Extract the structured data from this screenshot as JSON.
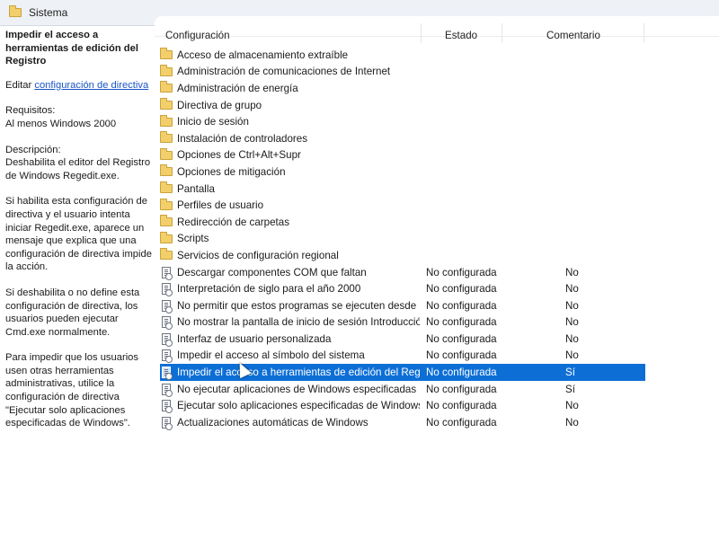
{
  "window": {
    "title": "Sistema",
    "title_icon": "folder-icon"
  },
  "left_pane": {
    "heading": "Impedir el acceso a herramientas de edición del Registro",
    "edit_prefix": "Editar ",
    "edit_link": "configuración de directiva",
    "requirements_label": "Requisitos:",
    "requirements_value": "Al menos Windows 2000",
    "description_label": "Descripción:",
    "description_text": "Deshabilita el editor del Registro de Windows Regedit.exe.",
    "paragraph_enabled": "Si habilita esta configuración de directiva y el usuario intenta iniciar Regedit.exe, aparece un mensaje que explica que una configuración de directiva impide la acción.",
    "paragraph_disabled": "Si deshabilita o no define esta configuración de directiva, los usuarios pueden ejecutar Cmd.exe normalmente.",
    "paragraph_block": "Para impedir que los usuarios usen otras herramientas administrativas, utilice la configuración de directiva \"Ejecutar solo aplicaciones especificadas de Windows\"."
  },
  "columns": {
    "config": "Configuración",
    "estado": "Estado",
    "comentario": "Comentario"
  },
  "folders": [
    "Acceso de almacenamiento extraíble",
    "Administración de comunicaciones de Internet",
    "Administración de energía",
    "Directiva de grupo",
    "Inicio de sesión",
    "Instalación de controladores",
    "Opciones de Ctrl+Alt+Supr",
    "Opciones de mitigación",
    "Pantalla",
    "Perfiles de usuario",
    "Redirección de carpetas",
    "Scripts",
    "Servicios de configuración regional"
  ],
  "settings": [
    {
      "name": "Descargar componentes COM que faltan",
      "state": "No configurada",
      "comment": "No"
    },
    {
      "name": "Interpretación de siglo para el año 2000",
      "state": "No configurada",
      "comment": "No"
    },
    {
      "name": "No permitir que estos programas se ejecuten desde la Ayuda",
      "state": "No configurada",
      "comment": "No"
    },
    {
      "name": "No mostrar la pantalla de inicio de sesión Introducción al ini...",
      "state": "No configurada",
      "comment": "No"
    },
    {
      "name": "Interfaz de usuario personalizada",
      "state": "No configurada",
      "comment": "No"
    },
    {
      "name": "Impedir el acceso al símbolo del sistema",
      "state": "No configurada",
      "comment": "No"
    },
    {
      "name": "Impedir el acceso a herramientas de edición del Registro",
      "state": "No configurada",
      "comment": "Sí"
    },
    {
      "name": "No ejecutar aplicaciones de Windows especificadas",
      "state": "No configurada",
      "comment": "Sí"
    },
    {
      "name": "Ejecutar solo aplicaciones especificadas de Windows",
      "state": "No configurada",
      "comment": "No"
    },
    {
      "name": "Actualizaciones automáticas de Windows",
      "state": "No configurada",
      "comment": "No"
    }
  ],
  "selection": {
    "selected_setting": "Impedir el acceso a herramientas de edición del Registro",
    "highlight_color": "#0d6fd6"
  }
}
